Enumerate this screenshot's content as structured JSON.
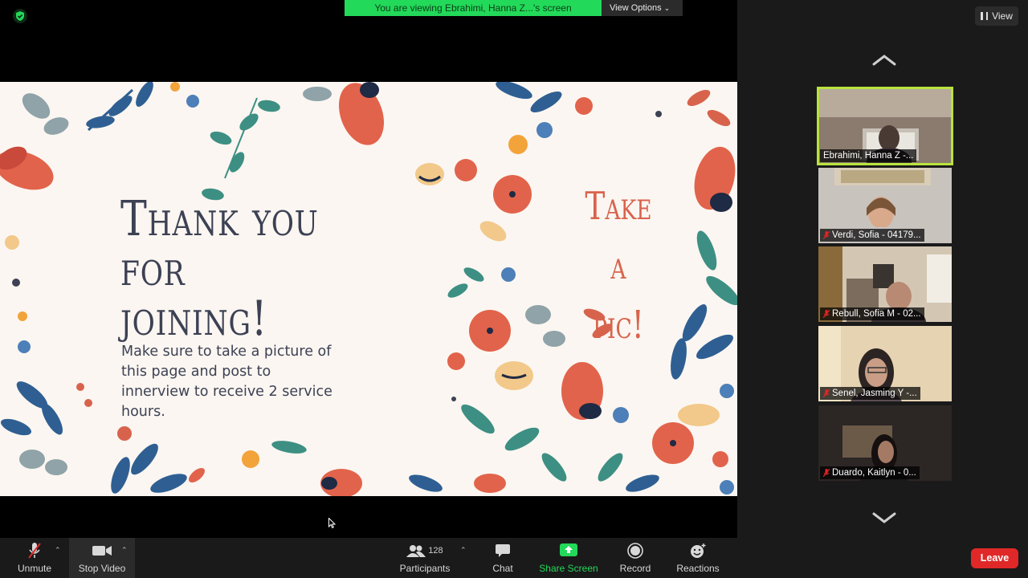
{
  "top_banner": {
    "viewing_text": "You are viewing Ebrahimi, Hanna Z...'s screen",
    "view_options_label": "View Options"
  },
  "gallery": {
    "view_label": "View",
    "participants": [
      {
        "name": "Ebrahimi, Hanna Z -...",
        "active": true,
        "muted": false
      },
      {
        "name": "Verdi, Sofia - 04179...",
        "active": false,
        "muted": true
      },
      {
        "name": "Rebull, Sofia M - 02...",
        "active": false,
        "muted": true
      },
      {
        "name": "Senel, Jasming Y -...",
        "active": false,
        "muted": true
      },
      {
        "name": "Duardo, Kaitlyn - 0...",
        "active": false,
        "muted": true
      }
    ]
  },
  "slide": {
    "title_line1": "Thank you for",
    "title_line2": "joining!",
    "body": "Make sure to take a picture of this page and post to innerview to receive 2 service hours.",
    "side_line1": "Take a",
    "side_line2": "pic!"
  },
  "toolbar": {
    "unmute_label": "Unmute",
    "stop_video_label": "Stop Video",
    "participants_label": "Participants",
    "participants_count": "128",
    "chat_label": "Chat",
    "share_screen_label": "Share Screen",
    "record_label": "Record",
    "reactions_label": "Reactions",
    "leave_label": "Leave"
  },
  "colors": {
    "banner_green": "#23d959",
    "active_speaker_border": "#b9e33c",
    "leave_red": "#e02828",
    "slide_bg": "#fbf6f1",
    "title_text": "#3d4154",
    "accent_coral": "#d8634d"
  }
}
